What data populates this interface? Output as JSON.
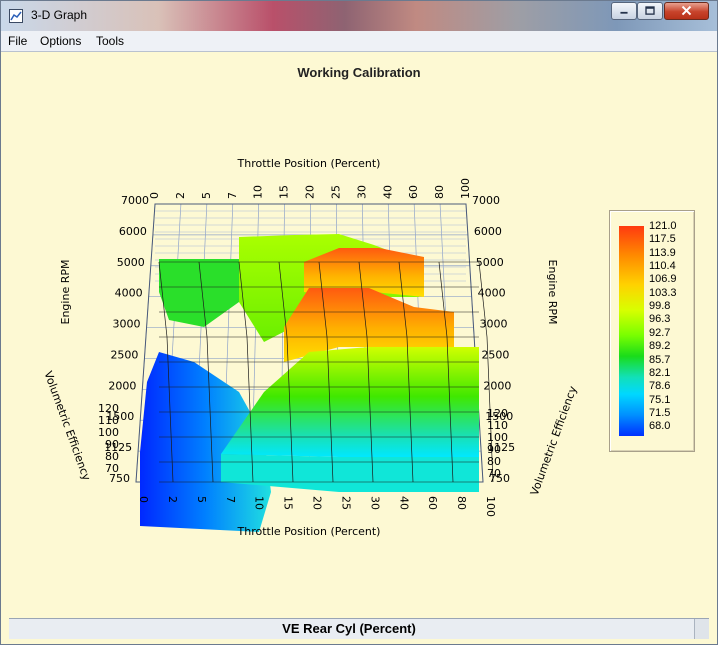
{
  "window": {
    "title": "3-D Graph",
    "icon": "graph-window-icon",
    "controls": [
      "minimize-icon",
      "maximize-icon",
      "close-icon"
    ]
  },
  "menu": {
    "file": "File",
    "options": "Options",
    "tools": "Tools"
  },
  "chart_data": {
    "type": "surface3d",
    "title": "Working Calibration",
    "x_axis_label": "Throttle Position (Percent)",
    "y_axis_label": "Engine RPM",
    "z_axis_label": "Volumetric Efficiency",
    "x_ticks": [
      "0",
      "2",
      "5",
      "7",
      "10",
      "15",
      "20",
      "25",
      "30",
      "40",
      "60",
      "80",
      "100"
    ],
    "y_ticks": [
      "750",
      "1125",
      "1500",
      "2000",
      "2500",
      "3000",
      "4000",
      "5000",
      "6000",
      "7000"
    ],
    "z_ticks": [
      "70",
      "80",
      "90",
      "100",
      "110",
      "120"
    ],
    "grid": true,
    "colorbar_position": "right",
    "colorbar_values": [
      "121.0",
      "117.5",
      "113.9",
      "110.4",
      "106.9",
      "103.3",
      "99.8",
      "96.3",
      "92.7",
      "89.2",
      "85.7",
      "82.1",
      "78.6",
      "75.1",
      "71.5",
      "68.0"
    ],
    "colors": {
      "high": "#ff3a10",
      "mid": "#d8ff00",
      "low": "#0030ff"
    }
  },
  "status": {
    "label": "VE Rear Cyl (Percent)"
  }
}
